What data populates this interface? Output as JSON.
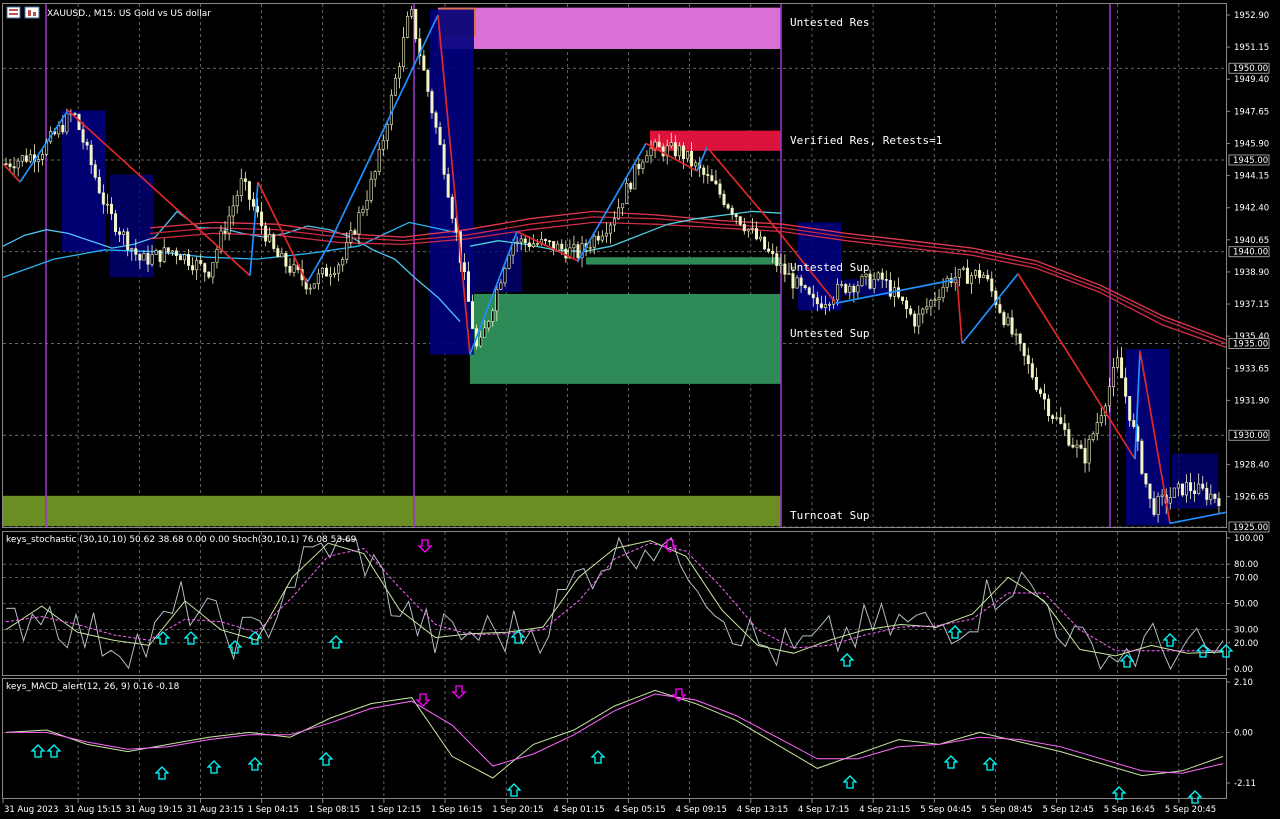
{
  "header": {
    "symbol_title": "XAUUSD., M15:  US Gold vs US dollar"
  },
  "zones": {
    "untested_res": "Untested Res",
    "verified_res": "Verified Res, Retests=1",
    "untested_sup_1": "Untested Sup",
    "untested_sup_2": "Untested Sup",
    "turncoat_sup": "Turncoat Sup"
  },
  "indicators": {
    "stoch_title": "keys_stochastic (30,10,10) 50.62 38.68 0.00 0.00 Stoch(30,10,1) 76.08 53.69",
    "macd_title": "keys_MACD_alert(12, 26, 9) 0.16 -0.18"
  },
  "price_axis": {
    "ticks": [
      "1952.90",
      "1951.15",
      "1949.40",
      "1947.65",
      "1945.90",
      "1944.15",
      "1942.40",
      "1940.65",
      "1938.90",
      "1937.15",
      "1935.40",
      "1933.65",
      "1931.90",
      "1928.40",
      "1926.65"
    ],
    "boxed": [
      "1950.00",
      "1945.00",
      "1940.00",
      "1935.00",
      "1930.00",
      "1925.00"
    ]
  },
  "stoch_axis": [
    "100.00",
    "80.00",
    "70.00",
    "50.00",
    "30.00",
    "20.00",
    "0.00"
  ],
  "macd_axis": [
    "2.10",
    "0.00",
    "-2.11"
  ],
  "time_axis": [
    "31 Aug 2023",
    "31 Aug 15:15",
    "31 Aug 19:15",
    "31 Aug 23:15",
    "1 Sep 04:15",
    "1 Sep 08:15",
    "1 Sep 12:15",
    "1 Sep 16:15",
    "1 Sep 20:15",
    "4 Sep 01:15",
    "4 Sep 05:15",
    "4 Sep 09:15",
    "4 Sep 13:15",
    "4 Sep 17:15",
    "4 Sep 21:15",
    "5 Sep 04:45",
    "5 Sep 08:45",
    "5 Sep 12:45",
    "5 Sep 16:45",
    "5 Sep 20:45"
  ],
  "colors": {
    "background": "#000000",
    "candle": "#f5f5c8",
    "zone_untested_res": "#da70d6",
    "zone_verified_res": "#dc143c",
    "zone_support": "#2e8b57",
    "zone_turncoat": "#6b8e23",
    "block": "#000080",
    "zigzag_up": "#1e90ff",
    "zigzag_down": "#e0282a",
    "separator": "#9932cc",
    "signal_up": "#00ffff",
    "signal_down": "#ff00ff"
  },
  "chart_data": {
    "type": "line",
    "title": "XAUUSD., M15:  US Gold vs US dollar",
    "xlabel": "",
    "ylabel": "",
    "ylim": [
      1925,
      1953.5
    ],
    "categories": [
      "31 Aug 2023",
      "31 Aug 15:15",
      "31 Aug 19:15",
      "31 Aug 23:15",
      "1 Sep 04:15",
      "1 Sep 08:15",
      "1 Sep 12:15",
      "1 Sep 16:15",
      "1 Sep 20:15",
      "4 Sep 01:15",
      "4 Sep 05:15",
      "4 Sep 09:15",
      "4 Sep 13:15",
      "4 Sep 17:15",
      "4 Sep 21:15",
      "5 Sep 04:45",
      "5 Sep 08:45",
      "5 Sep 12:45",
      "5 Sep 16:45",
      "5 Sep 20:45"
    ],
    "price_path": [
      1944.8,
      1945.4,
      1947.6,
      1942.2,
      1939.5,
      1940.1,
      1938.9,
      1943.8,
      1939.8,
      1938.2,
      1939.6,
      1944.5,
      1953.2,
      1944.7,
      1934.4,
      1940.6,
      1940.4,
      1939.9,
      1941.8,
      1945.6,
      1945.5,
      1943.6,
      1941.3,
      1939.1,
      1937.1,
      1938.2,
      1938.5,
      1936.2,
      1938.6,
      1938.8,
      1935.0,
      1931.3,
      1928.7,
      1934.0,
      1926.0,
      1927.2,
      1926.6
    ],
    "zones": [
      {
        "label": "Untested Res",
        "low": 1951.05,
        "high": 1953.3
      },
      {
        "label": "Verified Res, Retests=1",
        "low": 1945.5,
        "high": 1946.6
      },
      {
        "label": "Untested Sup",
        "low": 1939.3,
        "high": 1939.7
      },
      {
        "label": "Untested Sup",
        "low": 1932.8,
        "high": 1937.7
      },
      {
        "label": "Turncoat Sup",
        "low": 1925.05,
        "high": 1926.7
      }
    ],
    "stochastic": {
      "main_last": 50.62,
      "signal_last": 38.68,
      "ylim": [
        0,
        100
      ],
      "main": [
        30,
        48,
        28,
        22,
        18,
        52,
        30,
        22,
        70,
        96,
        88,
        45,
        24,
        27,
        28,
        32,
        70,
        92,
        98,
        86,
        45,
        18,
        12,
        22,
        30,
        34,
        32,
        42,
        70,
        52,
        15,
        10,
        18,
        12,
        13
      ],
      "signal": [
        36,
        40,
        34,
        26,
        22,
        38,
        36,
        28,
        55,
        86,
        92,
        62,
        34,
        26,
        27,
        30,
        52,
        84,
        96,
        90,
        62,
        30,
        16,
        18,
        26,
        32,
        33,
        38,
        58,
        58,
        30,
        14,
        14,
        14,
        14
      ]
    },
    "macd": {
      "main_last": 0.16,
      "signal_last": -0.18,
      "ylim": [
        -2.11,
        2.1
      ],
      "main": [
        0.0,
        0.1,
        -0.5,
        -0.8,
        -0.5,
        -0.2,
        0.0,
        -0.2,
        0.6,
        1.2,
        1.45,
        -1.0,
        -1.9,
        -0.5,
        0.1,
        1.1,
        1.75,
        1.2,
        0.5,
        -0.5,
        -1.5,
        -0.9,
        -0.3,
        -0.5,
        0.0,
        -0.4,
        -0.8,
        -1.3,
        -1.8,
        -1.6,
        -1.0
      ],
      "signal": [
        0.0,
        0.0,
        -0.4,
        -0.7,
        -0.6,
        -0.3,
        -0.1,
        -0.1,
        0.4,
        1.0,
        1.3,
        0.3,
        -1.4,
        -0.9,
        -0.1,
        0.9,
        1.6,
        1.35,
        0.7,
        -0.2,
        -1.1,
        -1.1,
        -0.6,
        -0.5,
        -0.2,
        -0.3,
        -0.6,
        -1.1,
        -1.6,
        -1.7,
        -1.3
      ]
    }
  }
}
